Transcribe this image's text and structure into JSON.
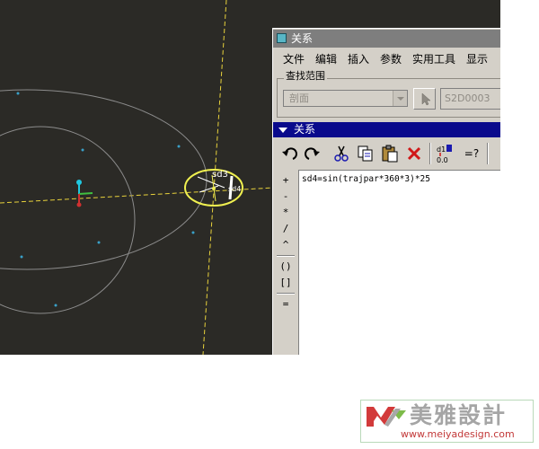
{
  "viewport": {
    "background": "#2b2a26",
    "dim_labels": [
      "sd3",
      "sd4"
    ],
    "colors": {
      "axis": "#e8d23c",
      "curve": "#8c8c8c",
      "point": "#3aa0c8",
      "highlight": "#f0f050"
    }
  },
  "dialog": {
    "title": "关系",
    "title_icon": "relations-window-icon",
    "menu": [
      "文件",
      "编辑",
      "插入",
      "参数",
      "实用工具",
      "显示"
    ],
    "search_scope": {
      "label": "查找范围",
      "selected": "剖面",
      "pick_icon": "select-arrow-icon",
      "value": "S2D0003"
    },
    "section_header": "关系",
    "toolbar": [
      "undo-icon",
      "redo-icon",
      "cut-icon",
      "copy-icon",
      "paste-icon",
      "delete-icon",
      "sort-relations-icon",
      "evaluate-icon"
    ],
    "toolbar_labels": {
      "evaluate": "=?",
      "sort_top": "d1",
      "sort_bottom": "0.0"
    },
    "operators": [
      "+",
      "-",
      "*",
      "/",
      "^",
      "()",
      "[]",
      "="
    ],
    "relation_text": "sd4=sin(trajpar*360*3)*25"
  },
  "watermark": {
    "brand_cn": "美雅設計",
    "url": "www.meiyadesign.com",
    "colors": {
      "text": "#a5a5a5",
      "url": "#c23838",
      "logo_red": "#d23a3a",
      "logo_green": "#7dbb4a"
    }
  }
}
